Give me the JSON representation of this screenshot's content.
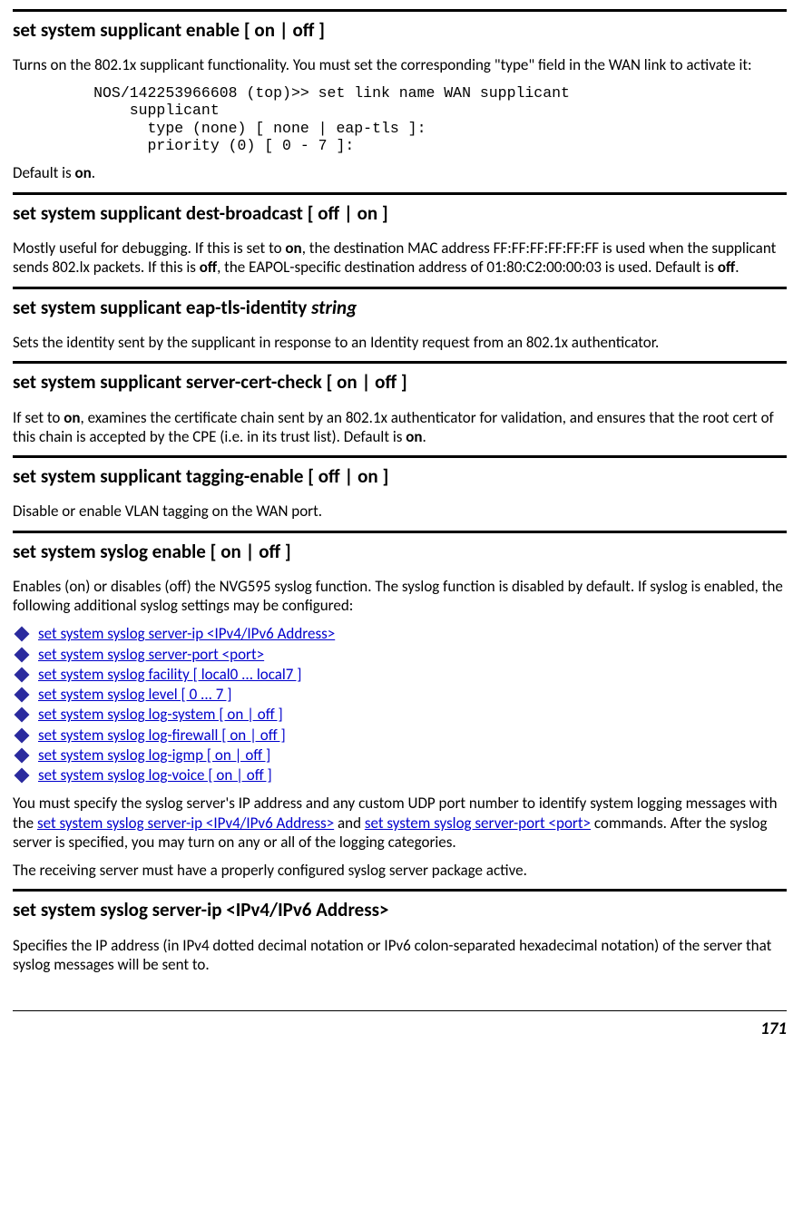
{
  "sec1": {
    "title": "set system supplicant enable [ on | off ]",
    "p1": "Turns on the 802.1x supplicant functionality. You must set the corresponding \"type\" field in the WAN link to activate it:",
    "code": "         NOS/142253966608 (top)>> set link name WAN supplicant\n             supplicant\n               type (none) [ none | eap-tls ]:\n               priority (0) [ 0 - 7 ]:",
    "p2_a": "Default is ",
    "p2_b": "on",
    "p2_c": "."
  },
  "sec2": {
    "title": "set system supplicant dest-broadcast [ off | on ]",
    "p1_a": "Mostly useful for debugging. If this is set to ",
    "p1_b": "on",
    "p1_c": ", the destination MAC address FF:FF:FF:FF:FF:FF is used when the supplicant sends 802.lx packets. If this is ",
    "p1_d": "off",
    "p1_e": ", the EAPOL-specific destination address of 01:80:C2:00:00:03 is used. Default is ",
    "p1_f": "off",
    "p1_g": "."
  },
  "sec3": {
    "title_a": "set system supplicant eap-tls-identity ",
    "title_b": "string",
    "p1": "Sets the identity sent by the supplicant in response to an Identity request from an 802.1x authenticator."
  },
  "sec4": {
    "title": "set system supplicant server-cert-check [ on | off ]",
    "p1_a": "If set to ",
    "p1_b": "on",
    "p1_c": ", examines the certificate chain sent by an 802.1x authenticator for validation, and ensures that the root cert of this chain is accepted by the CPE (i.e. in its trust list). Default is ",
    "p1_d": "on",
    "p1_e": "."
  },
  "sec5": {
    "title": "set system supplicant tagging-enable  [ off | on ]",
    "p1": "Disable or enable VLAN tagging on the WAN port."
  },
  "sec6": {
    "title": "set system syslog enable [ on | off ]",
    "p1": "Enables (on) or disables (off) the NVG595 syslog function. The syslog function is disabled by default. If syslog is enabled, the following additional syslog settings may be configured:",
    "bullets": [
      "set system syslog server-ip <IPv4/IPv6 Address>",
      "set system syslog server-port <port>",
      "set system syslog facility [ local0 ... local7 ]",
      "set system syslog level [ 0 ... 7 ]",
      "set system syslog log-system [ on | off ]",
      "set system syslog log-firewall [ on | off ]",
      "set system syslog log-igmp [ on | off ]",
      "set system syslog log-voice [ on | off ]"
    ],
    "p2_a": "You must specify the syslog server's IP address and any custom UDP port number to identify system logging messages with the ",
    "p2_b": "set system syslog server-ip <IPv4/IPv6 Address>",
    "p2_c": " and ",
    "p2_d": "set system syslog server-port <port>",
    "p2_e": " commands. After the syslog server is specified, you may turn on any or all of the logging categories.",
    "p3": "The receiving server must have a properly configured syslog server package active."
  },
  "sec7": {
    "title": "set system syslog  server-ip <IPv4/IPv6 Address>",
    "p1": "Specifies the IP address (in IPv4 dotted decimal notation or IPv6 colon-separated hexadecimal notation) of the server that syslog messages will be sent to."
  },
  "page_number": "171"
}
